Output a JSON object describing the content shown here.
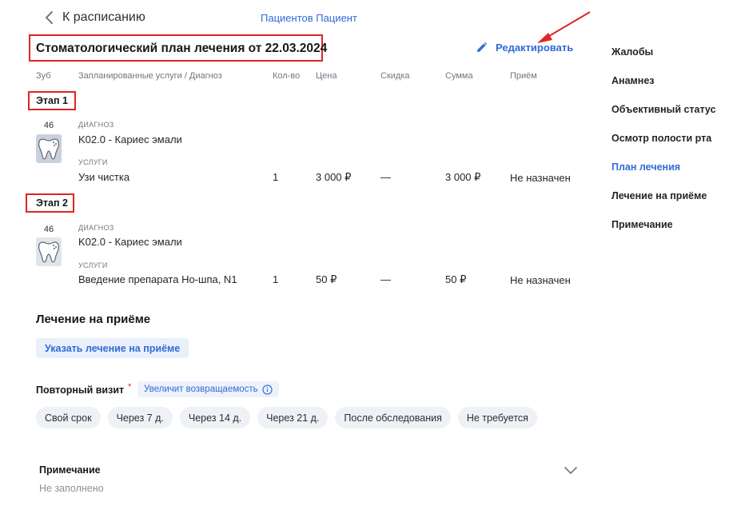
{
  "header": {
    "back_label": "К расписанию",
    "patient_link": "Пациентов Пациент"
  },
  "plan": {
    "title": "Стоматологический план лечения от 22.03.2024",
    "edit_label": "Редактировать",
    "columns": [
      "Зуб",
      "Запланированные услуги / Диагноз",
      "Кол-во",
      "Цена",
      "Скидка",
      "Сумма",
      "Приём"
    ],
    "stages": [
      {
        "label": "Этап 1",
        "tooth": "46",
        "diagnosis_label": "ДИАГНОЗ",
        "diagnosis": "K02.0 - Кариес эмали",
        "services_label": "УСЛУГИ",
        "service": "Узи чистка",
        "qty": "1",
        "price": "3 000 ₽",
        "discount": "—",
        "sum": "3 000 ₽",
        "appointment": "Не назначен"
      },
      {
        "label": "Этап 2",
        "tooth": "46",
        "diagnosis_label": "ДИАГНОЗ",
        "diagnosis": "K02.0 - Кариес эмали",
        "services_label": "УСЛУГИ",
        "service": "Введение препарата Но-шпа, N1",
        "qty": "1",
        "price": "50 ₽",
        "discount": "—",
        "sum": "50 ₽",
        "appointment": "Не назначен"
      }
    ]
  },
  "treatment": {
    "title": "Лечение на приёме",
    "button": "Указать лечение на приёме"
  },
  "revisit": {
    "label": "Повторный визит",
    "required_mark": "*",
    "hint": "Увеличит возвращаемость",
    "options": [
      "Свой срок",
      "Через 7 д.",
      "Через 14 д.",
      "Через 21 д.",
      "После обследования",
      "Не требуется"
    ]
  },
  "note": {
    "title": "Примечание",
    "value": "Не заполнено"
  },
  "sidebar": {
    "items": [
      {
        "label": "Жалобы",
        "active": false
      },
      {
        "label": "Анамнез",
        "active": false
      },
      {
        "label": "Объективный статус",
        "active": false
      },
      {
        "label": "Осмотр полости рта",
        "active": false
      },
      {
        "label": "План лечения",
        "active": true
      },
      {
        "label": "Лечение на приёме",
        "active": false
      },
      {
        "label": "Примечание",
        "active": false
      }
    ]
  },
  "colors": {
    "accent": "#2f6bd6",
    "highlight": "#e02424"
  }
}
